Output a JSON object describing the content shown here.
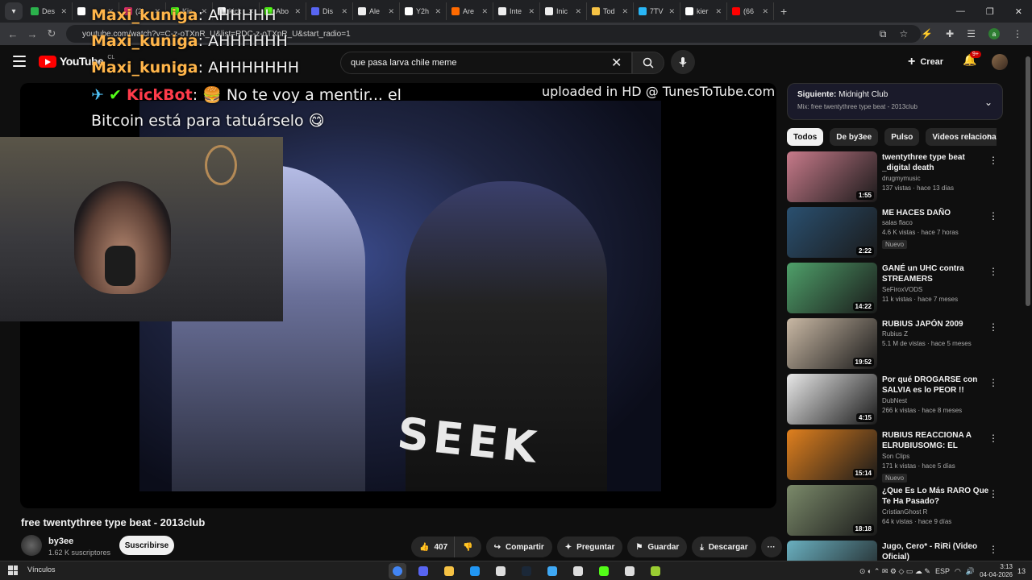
{
  "browser": {
    "tabs": [
      {
        "label": "Des",
        "color": "#2bb24c"
      },
      {
        "label": "",
        "color": "#ffffff"
      },
      {
        "label": "(2)",
        "color": "#e1306c"
      },
      {
        "label": "Kic",
        "color": "#53fc18"
      },
      {
        "label": "kick",
        "color": "#ffffff"
      },
      {
        "label": "Abo",
        "color": "#53fc18"
      },
      {
        "label": "Dis",
        "color": "#5865f2"
      },
      {
        "label": "Ale",
        "color": "#eeeeee"
      },
      {
        "label": "Y2h",
        "color": "#ffffff"
      },
      {
        "label": "Are",
        "color": "#ff6a00"
      },
      {
        "label": "Inte",
        "color": "#eeeeee"
      },
      {
        "label": "Inic",
        "color": "#eeeeee"
      },
      {
        "label": "Tod",
        "color": "#f6c244"
      },
      {
        "label": "7TV",
        "color": "#29b6f6"
      },
      {
        "label": "kier",
        "color": "#ffffff"
      },
      {
        "label": "(66",
        "color": "#ff0000"
      }
    ],
    "url": "youtube.com/watch?v=C-z-oTXnR_U&list=RDC-z-oTXnR_U&start_radio=1",
    "profile_letter": "a"
  },
  "yt": {
    "logo_text": "YouTube",
    "country": "CL",
    "search_value": "que pasa larva chile meme",
    "create_label": "Crear",
    "notif_count": "9+"
  },
  "overlay": {
    "chat": [
      {
        "user": "Maxi_kuniga",
        "msg": ": AHHHHH"
      },
      {
        "user": "Maxi_kuniga",
        "msg": ": AHHHHHH"
      },
      {
        "user": "Maxi_kuniga",
        "msg": ": AHHHHHHH"
      }
    ],
    "bot_user": "KickBot",
    "bot_line1": "No te voy a mentir... el",
    "bot_line2": "Bitcoin está para tatuárselo",
    "watermark": "uploaded in HD @ TunesToTube.com",
    "shirt_text": "SEEK"
  },
  "video": {
    "title": "free twentythree type beat - 2013club",
    "channel": "by3ee",
    "subs": "1.62 K suscriptores",
    "subscribe": "Suscribirse",
    "likes": "407",
    "share": "Compartir",
    "ask": "Preguntar",
    "save": "Guardar",
    "download": "Descargar"
  },
  "sidebar": {
    "next_label": "Siguiente:",
    "next_title": "Midnight Club",
    "next_mix": "Mix: free twentythree type beat - 2013club",
    "chips": [
      "Todos",
      "De by3ee",
      "Pulso",
      "Videos relacionados"
    ],
    "items": [
      {
        "title": "twentythree type beat _digital death",
        "channel": "drugmymusic",
        "meta": "137 vistas · hace 13 días",
        "duration": "1:55",
        "badge": "",
        "thumb": "#c77a8a"
      },
      {
        "title": "ME HACES DAÑO",
        "channel": "salas flaco",
        "meta": "4.6 K vistas · hace 7 horas",
        "duration": "2:22",
        "badge": "Nuevo",
        "thumb": "#2a5070"
      },
      {
        "title": "GANÉ un UHC contra STREAMERS",
        "channel": "SeFiroxVODS",
        "meta": "11 k vistas · hace 7 meses",
        "duration": "14:22",
        "badge": "",
        "thumb": "#4fa06a"
      },
      {
        "title": "RUBIUS JAPÓN 2009",
        "channel": "Rubius Z",
        "meta": "5.1 M de vistas · hace 5 meses",
        "duration": "19:52",
        "badge": "",
        "thumb": "#c9b8a4"
      },
      {
        "title": "Por qué DROGARSE con SALVIA es lo PEOR !!",
        "channel": "DubNest",
        "meta": "266 k vistas · hace 8 meses",
        "duration": "4:15",
        "badge": "",
        "thumb": "#e8e8e8"
      },
      {
        "title": "RUBIUS REACCIONA A ELRUBIUSOMG: EL YOUTUBER...",
        "channel": "Son Clips",
        "meta": "171 k vistas · hace 5 días",
        "duration": "15:14",
        "badge": "Nuevo",
        "thumb": "#e0801e"
      },
      {
        "title": "¿Que Es Lo Más RARO Que Te Ha Pasado?",
        "channel": "CristianGhost R",
        "meta": "64 k vistas · hace 9 días",
        "duration": "18:18",
        "badge": "",
        "thumb": "#7b8a6a"
      },
      {
        "title": "Jugo, Cero* - RiRi (Video Oficial)",
        "channel": "",
        "meta": "",
        "duration": "",
        "badge": "",
        "thumb": "#6ab0c0"
      }
    ]
  },
  "taskbar": {
    "label": "Vínculos",
    "lang": "ESP",
    "time": "3:13",
    "date": "04-04-2026",
    "notif": "13"
  }
}
